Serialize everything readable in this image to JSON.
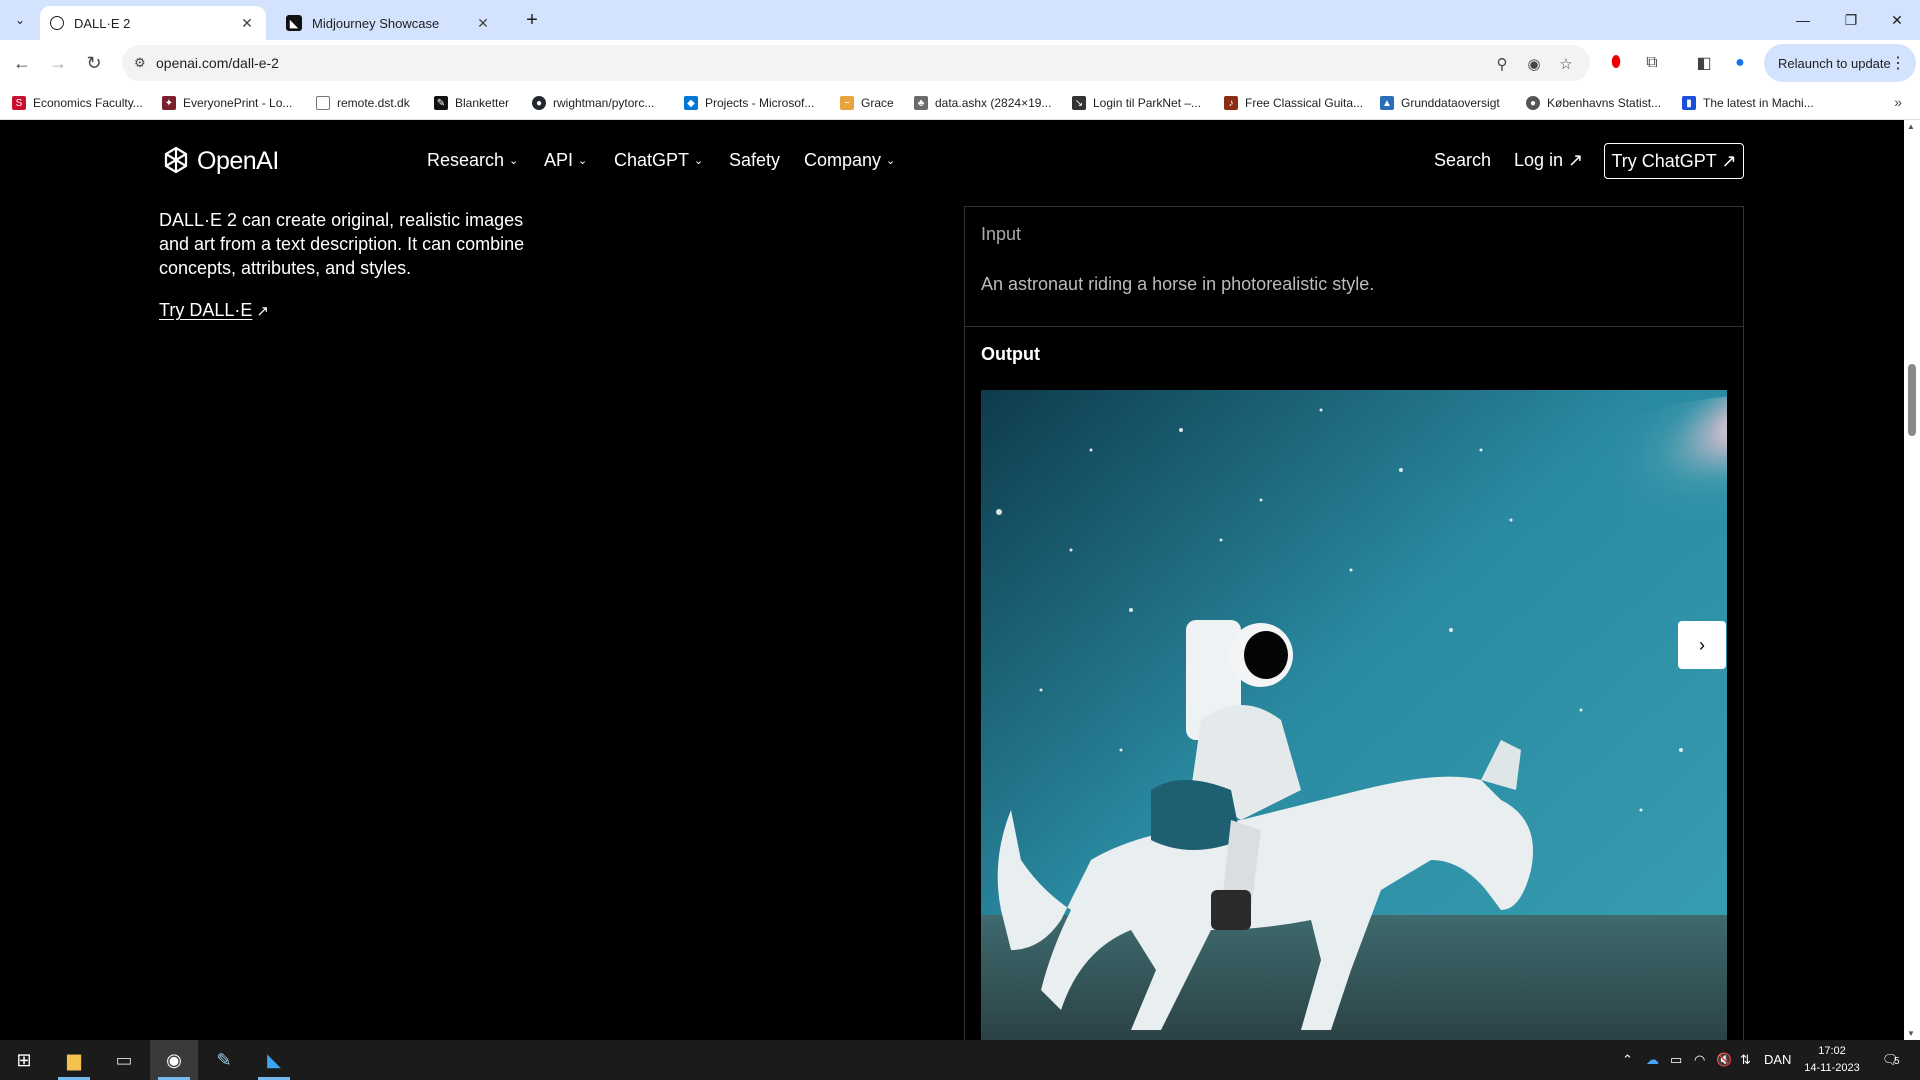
{
  "browser": {
    "tabs": [
      {
        "title": "DALL·E 2",
        "active": true
      },
      {
        "title": "Midjourney Showcase",
        "active": false
      }
    ],
    "url": "openai.com/dall-e-2",
    "relaunch_label": "Relaunch to update",
    "bookmarks": [
      {
        "label": "Economics Faculty...",
        "icon_color": "#c8102e"
      },
      {
        "label": "EveryonePrint - Lo...",
        "icon_color": "#7a1f2b"
      },
      {
        "label": "remote.dst.dk",
        "icon_color": "#777777"
      },
      {
        "label": "Blanketter",
        "icon_color": "#111111"
      },
      {
        "label": "rwightman/pytorc...",
        "icon_color": "#24292f"
      },
      {
        "label": "Projects - Microsof...",
        "icon_color": "#0078d4"
      },
      {
        "label": "Grace",
        "icon_color": "#e8a33d"
      },
      {
        "label": "data.ashx (2824×19...",
        "icon_color": "#6b6b6b"
      },
      {
        "label": "Login til ParkNet –...",
        "icon_color": "#333333"
      },
      {
        "label": "Free Classical Guita...",
        "icon_color": "#8b2e16"
      },
      {
        "label": "Grunddataoversigt",
        "icon_color": "#2a6ebb"
      },
      {
        "label": "Københavns Statist...",
        "icon_color": "#555555"
      },
      {
        "label": "The latest in Machi...",
        "icon_color": "#1a4fd8"
      }
    ]
  },
  "site": {
    "logo_text": "OpenAI",
    "nav": {
      "research": "Research",
      "api": "API",
      "chatgpt": "ChatGPT",
      "safety": "Safety",
      "company": "Company",
      "search": "Search",
      "login": "Log in ↗",
      "try_chatgpt": "Try ChatGPT ↗"
    },
    "intro": "DALL·E 2 can create original, realistic images and art from a text description. It can combine concepts, attributes, and styles.",
    "try_link": "Try DALL·E",
    "card": {
      "input_heading": "Input",
      "prompt": "An astronaut riding a horse in photorealistic style.",
      "output_heading": "Output"
    }
  },
  "taskbar": {
    "language": "DAN",
    "time": "17:02",
    "date": "14-11-2023",
    "notifications": "5"
  },
  "colors": {
    "tabstrip": "#d3e3fd",
    "page_bg": "#000000",
    "card_border": "#333333",
    "taskbar": "#1b1b1b"
  }
}
